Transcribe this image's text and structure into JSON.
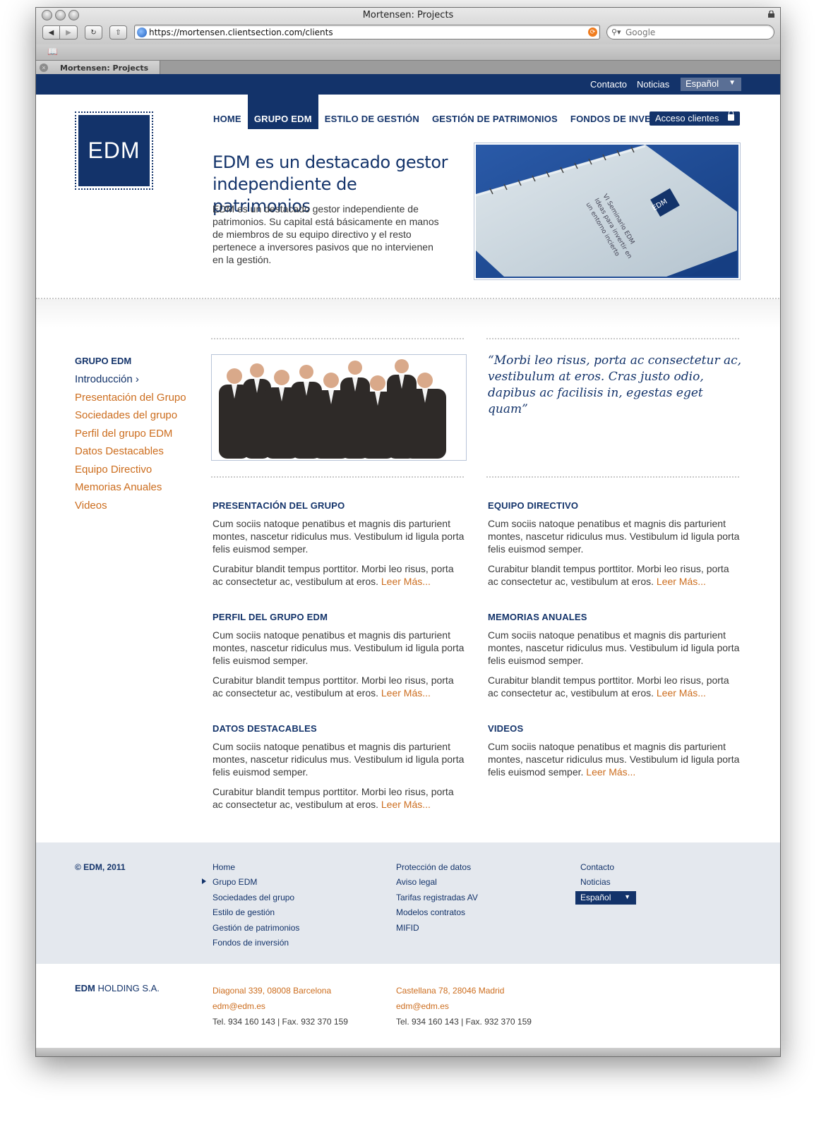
{
  "browser": {
    "window_title": "Mortensen: Projects",
    "url": "https://mortensen.clientsection.com/clients",
    "search_placeholder": "Google",
    "tab_label": "Mortensen: Projects"
  },
  "topbar": {
    "links": [
      "Contacto",
      "Noticias"
    ],
    "language": "Español"
  },
  "logo": {
    "text": "EDM"
  },
  "nav": {
    "items": [
      "HOME",
      "GRUPO EDM",
      "ESTILO DE GESTIÓN",
      "GESTIÓN DE PATRIMONIOS",
      "FONDOS DE INVERSIÓN"
    ],
    "active": "GRUPO EDM",
    "access_label": "Acceso clientes"
  },
  "hero": {
    "title": "EDM es un destacado gestor independiente de patrimonios",
    "text": "EDM es un destacado gestor independiente de patrimonios. Su capital está básicamente en manos de miembros de su equipo directivo y el resto pertenece a inversores pasivos que no intervienen en la gestión.",
    "image_logo": "EDM",
    "image_caption": [
      "VI Seminario EDM",
      "Ideas para invertir en",
      "un entorno incierto"
    ]
  },
  "subnav": {
    "title": "GRUPO EDM",
    "items": [
      "Introducción ›",
      "Presentación del Grupo",
      "Sociedades del grupo",
      "Perfil del grupo EDM",
      "Datos Destacables",
      "Equipo Directivo",
      "Memorias Anuales",
      "Videos"
    ]
  },
  "quote": "“Morbi leo risus, porta ac consectetur ac, vestibulum at eros. Cras justo odio, dapibus ac facilisis in, egestas eget quam”",
  "sections": [
    {
      "title": "PRESENTACIÓN DEL GRUPO",
      "p1": "Cum sociis natoque penatibus et magnis dis parturient montes, nascetur ridiculus mus. Vestibulum id ligula porta felis euismod semper.",
      "p2": "Curabitur blandit tempus porttitor. Morbi leo risus, porta ac consectetur ac, vestibulum at eros.",
      "more": "Leer Más..."
    },
    {
      "title": "EQUIPO DIRECTIVO",
      "p1": "Cum sociis natoque penatibus et magnis dis parturient montes, nascetur ridiculus mus. Vestibulum id ligula porta felis euismod semper.",
      "p2": "Curabitur blandit tempus porttitor. Morbi leo risus, porta ac consectetur ac, vestibulum at eros.",
      "more": "Leer Más..."
    },
    {
      "title": "PERFIL DEL GRUPO EDM",
      "p1": "Cum sociis natoque penatibus et magnis dis parturient montes, nascetur ridiculus mus. Vestibulum id ligula porta felis euismod semper.",
      "p2": "Curabitur blandit tempus porttitor. Morbi leo risus, porta ac consectetur ac, vestibulum at eros.",
      "more": "Leer Más..."
    },
    {
      "title": "MEMORIAS ANUALES",
      "p1": "Cum sociis natoque penatibus et magnis dis parturient montes, nascetur ridiculus mus. Vestibulum id ligula porta felis euismod semper.",
      "p2": "Curabitur blandit tempus porttitor. Morbi leo risus, porta ac consectetur ac, vestibulum at eros.",
      "more": "Leer Más..."
    },
    {
      "title": "DATOS DESTACABLES",
      "p1": "Cum sociis natoque penatibus et magnis dis parturient montes, nascetur ridiculus mus. Vestibulum id ligula porta felis euismod semper.",
      "p2": "Curabitur blandit tempus porttitor. Morbi leo risus, porta ac consectetur ac, vestibulum at eros.",
      "more": "Leer Más..."
    },
    {
      "title": "VIDEOS",
      "p1": "Cum sociis natoque penatibus et magnis dis parturient montes, nascetur ridiculus mus. Vestibulum id ligula porta felis euismod semper.",
      "more": "Leer Más..."
    }
  ],
  "footer": {
    "copyright": "© EDM, 2011",
    "col1": [
      "Home",
      "Grupo EDM",
      "Sociedades del grupo",
      "Estilo de gestión",
      "Gestión de patrimonios",
      "Fondos de inversión"
    ],
    "col2": [
      "Protección de datos",
      "Aviso legal",
      "Tarifas registradas AV",
      "Modelos contratos",
      "MIFID"
    ],
    "col3": [
      "Contacto",
      "Noticias"
    ],
    "language": "Español",
    "holding_brand": "EDM",
    "holding_rest": "HOLDING S.A.",
    "office1": {
      "address": "Diagonal 339, 08008 Barcelona",
      "email": "edm@edm.es",
      "phones": "Tel. 934 160 143  |  Fax. 932 370 159"
    },
    "office2": {
      "address": "Castellana 78, 28046 Madrid",
      "email": "edm@edm.es",
      "phones": "Tel. 934 160 143  |  Fax. 932 370 159"
    }
  },
  "colors": {
    "navy": "#13336a",
    "orange": "#cc6d1e",
    "footer_bg": "#e4e8ee"
  }
}
